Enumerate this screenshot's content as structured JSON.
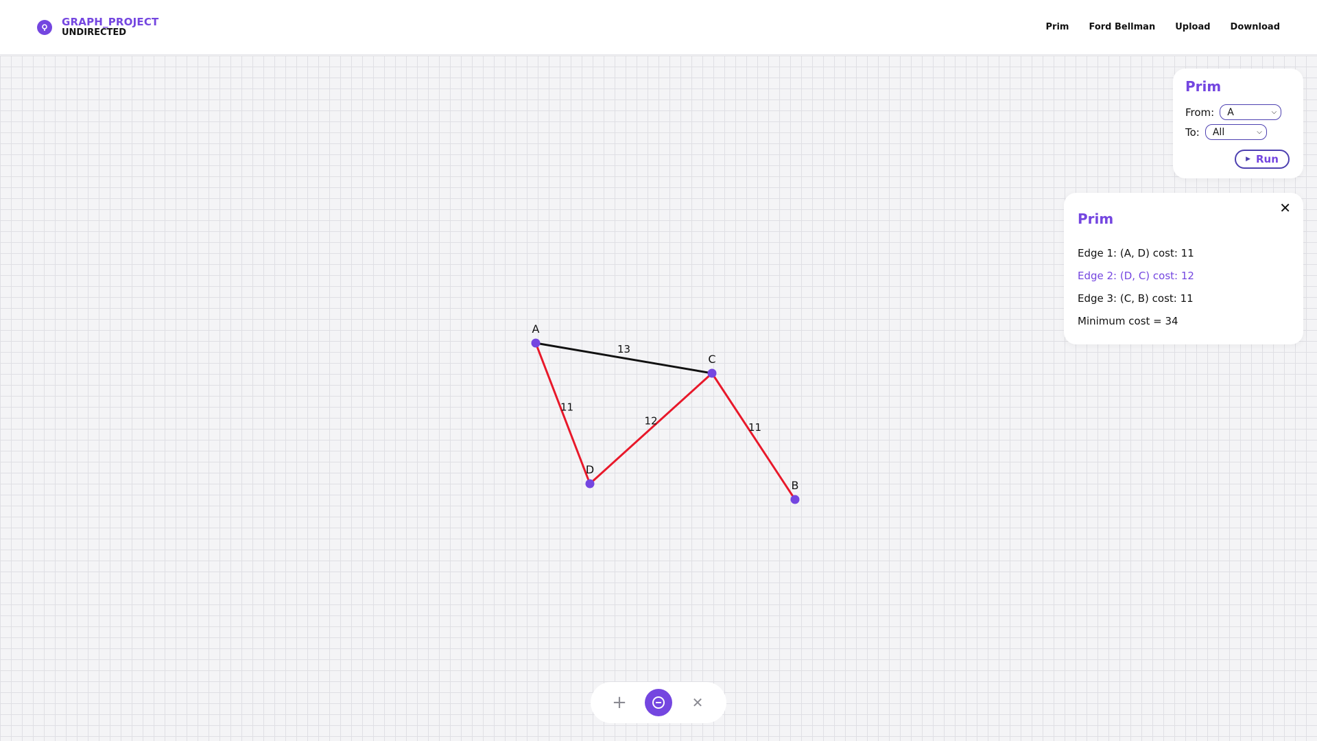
{
  "header": {
    "title": "GRAPH_PROJECT",
    "subtitle": "UNDIRECTED",
    "nav": [
      {
        "label": "Prim"
      },
      {
        "label": "Ford Bellman"
      },
      {
        "label": "Upload"
      },
      {
        "label": "Download"
      }
    ]
  },
  "control": {
    "title": "Prim",
    "from_label": "From:",
    "from_value": "A",
    "to_label": "To:",
    "to_value": "All",
    "run_label": "Run"
  },
  "result": {
    "title": "Prim",
    "items": [
      {
        "text": "Edge 1: (A, D) cost: 11"
      },
      {
        "text": "Edge 2: (D, C) cost: 12"
      },
      {
        "text": "Edge 3: (C, B) cost: 11"
      },
      {
        "text": "Minimum cost = 34"
      }
    ],
    "active_index": 1
  },
  "graph": {
    "nodes": [
      {
        "id": "A"
      },
      {
        "id": "C"
      },
      {
        "id": "D"
      },
      {
        "id": "B"
      }
    ],
    "edges": [
      {
        "from": "A",
        "to": "C",
        "weight": "13",
        "in_tree": false
      },
      {
        "from": "A",
        "to": "D",
        "weight": "11",
        "in_tree": true
      },
      {
        "from": "D",
        "to": "C",
        "weight": "12",
        "in_tree": true
      },
      {
        "from": "C",
        "to": "B",
        "weight": "11",
        "in_tree": true
      }
    ]
  },
  "toolbar": {
    "add_icon": "plus-icon",
    "remove_icon": "minus-circle-icon",
    "clear_icon": "close-icon"
  },
  "colors": {
    "accent": "#7446e0",
    "tree_edge": "#e8182a",
    "edge": "#111111",
    "node": "#7446e0"
  }
}
